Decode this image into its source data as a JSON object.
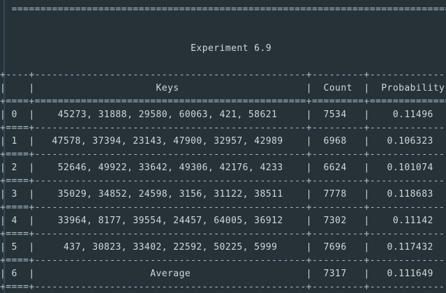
{
  "top_rule": "  ===============================================================================",
  "title": "Experiment 6.9",
  "table": {
    "border_plus": "+----+-----------------------------------------------+---------+---------------+",
    "header_rule": "+====+===============================================+=========+===============+",
    "row_rule": "+====+-----------------------------------------------+---------+---------------+",
    "columns": [
      "",
      "Keys",
      "Count",
      "Probability"
    ],
    "rows": [
      {
        "idx": "0",
        "keys": "45273, 31888, 29580, 60063, 421, 58621",
        "count": "7534",
        "prob": "0.11496"
      },
      {
        "idx": "1",
        "keys": "47578, 37394, 23143, 47900, 32957, 42989",
        "count": "6968",
        "prob": "0.106323"
      },
      {
        "idx": "2",
        "keys": "52646, 49922, 33642, 49306, 42176, 4233",
        "count": "6624",
        "prob": "0.101074"
      },
      {
        "idx": "3",
        "keys": "35029, 34852, 24598, 3156, 31122, 38511",
        "count": "7778",
        "prob": "0.118683"
      },
      {
        "idx": "4",
        "keys": "33964, 8177, 39554, 24457, 64005, 36912",
        "count": "7302",
        "prob": "0.11142"
      },
      {
        "idx": "5",
        "keys": "437, 30823, 33402, 22592, 50225, 5999",
        "count": "7696",
        "prob": "0.117432"
      },
      {
        "idx": "6",
        "keys": "Average",
        "count": "7317",
        "prob": "0.111649"
      }
    ]
  }
}
